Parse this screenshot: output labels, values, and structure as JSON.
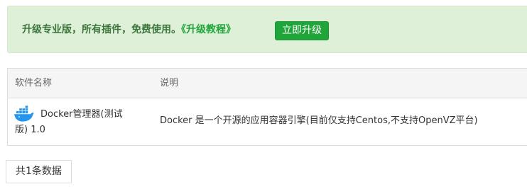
{
  "banner": {
    "message": "升级专业版，所有插件，免费使用。",
    "tutorial_link": "《升级教程》",
    "upgrade_button": "立即升级"
  },
  "table": {
    "headers": {
      "name": "软件名称",
      "description": "说明"
    },
    "rows": [
      {
        "icon": "docker-icon",
        "name_line1": "Docker管理器(测试",
        "name_line2": "版) 1.0",
        "description": "Docker 是一个开源的应用容器引擎(目前仅支持Centos,不支持OpenVZ平台)"
      }
    ]
  },
  "pagination": {
    "total_text": "共1条数据"
  },
  "colors": {
    "accent_green": "#20a53a",
    "banner_bg": "#dff0d8",
    "banner_text": "#3c763d"
  }
}
